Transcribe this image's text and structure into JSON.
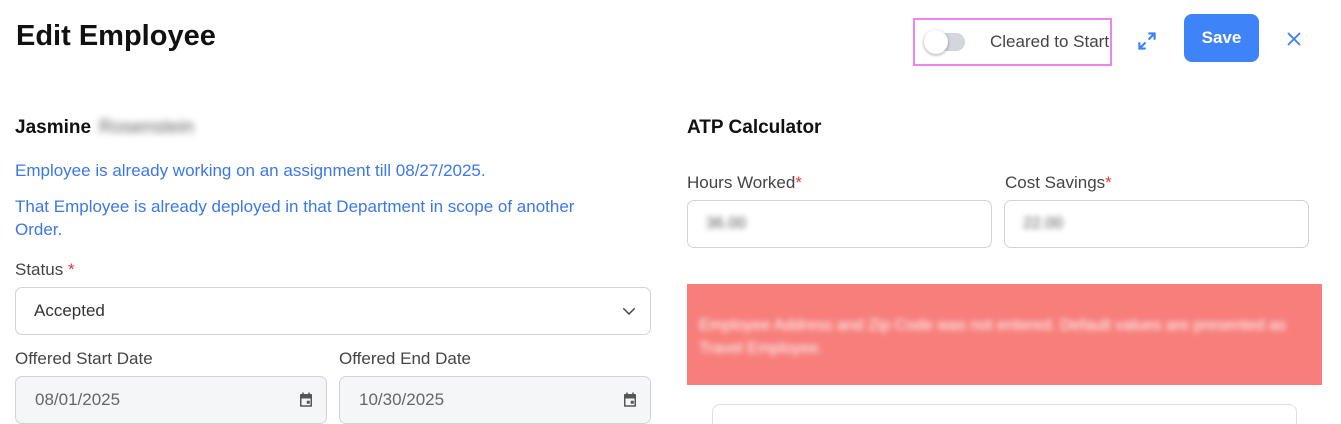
{
  "header": {
    "title": "Edit Employee",
    "toggle_label": "Cleared to Start",
    "toggle_on": false,
    "save_label": "Save"
  },
  "employee": {
    "first_name": "Jasmine",
    "last_name_redacted": "Rosenstein"
  },
  "messages": {
    "assignment_notice": "Employee is already working on an assignment till 08/27/2025.",
    "department_notice": "That Employee is already deployed in that Department in scope of another Order."
  },
  "form": {
    "status_label": "Status",
    "status_value": "Accepted",
    "offered_start_label": "Offered Start Date",
    "offered_start_value": "08/01/2025",
    "offered_end_label": "Offered End Date",
    "offered_end_value": "10/30/2025",
    "required_mark": "*"
  },
  "atp": {
    "title": "ATP Calculator",
    "hours_label": "Hours Worked",
    "hours_value_redacted": "36.00",
    "cost_label": "Cost Savings",
    "cost_value_redacted": "22.00",
    "alert_text_redacted": "Employee Address and Zip Code was not entered. Default values are presented as Travel Employee."
  },
  "colors": {
    "accent": "#3f83f8",
    "link": "#3b78e7",
    "alert_bg": "#f77e7b",
    "highlight_border": "#ee82ee"
  },
  "icons": {
    "expand": "expand-icon",
    "close": "close-icon",
    "chevron": "chevron-down-icon",
    "calendar": "calendar-icon"
  }
}
